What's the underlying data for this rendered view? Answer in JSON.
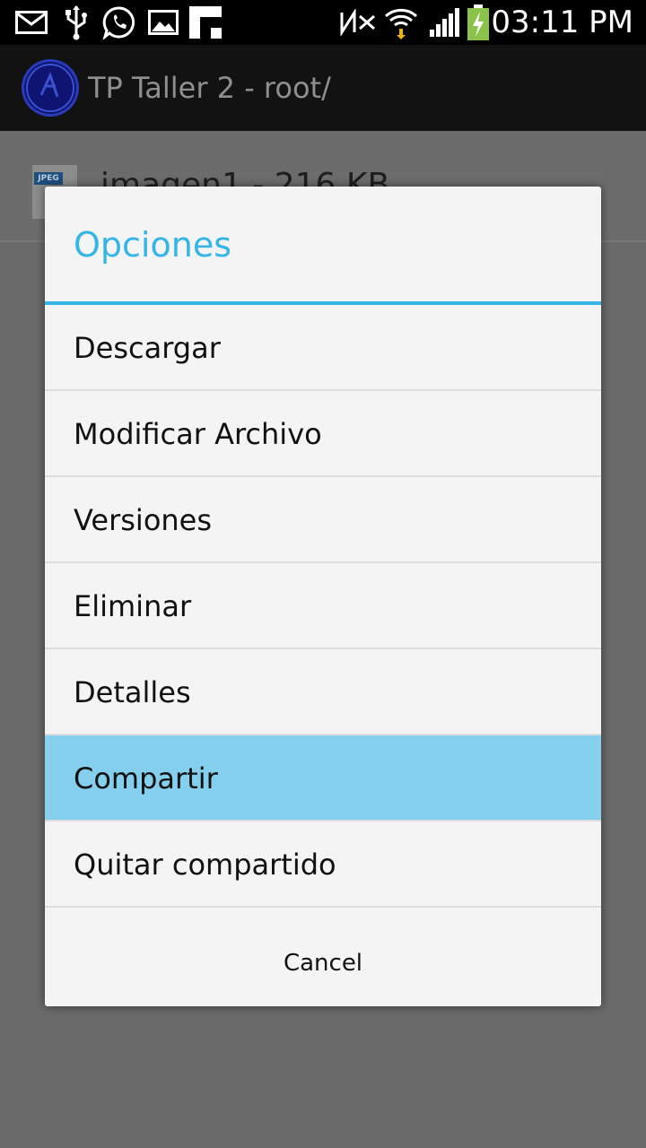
{
  "status_bar": {
    "time": "03:11 PM",
    "icons": [
      "mail-icon",
      "usb-icon",
      "whatsapp-icon",
      "image-icon",
      "flipboard-icon",
      "nfc-icon",
      "wifi-icon",
      "signal-icon",
      "battery-charging-icon"
    ]
  },
  "app": {
    "title": "TP Taller 2 - root/",
    "file": {
      "label": "imagen1 - 216 KB",
      "icon_tag": "JPEG"
    }
  },
  "dialog": {
    "title": "Opciones",
    "options": [
      {
        "label": "Descargar"
      },
      {
        "label": "Modificar Archivo"
      },
      {
        "label": "Versiones"
      },
      {
        "label": "Eliminar"
      },
      {
        "label": "Detalles"
      },
      {
        "label": "Compartir"
      },
      {
        "label": "Quitar compartido"
      }
    ],
    "selected_option": "Compartir",
    "cancel_label": "Cancel"
  },
  "colors": {
    "accent": "#33b5e5",
    "selected_row": "#84cfed",
    "status_bar": "#000000",
    "action_bar": "#121212"
  }
}
